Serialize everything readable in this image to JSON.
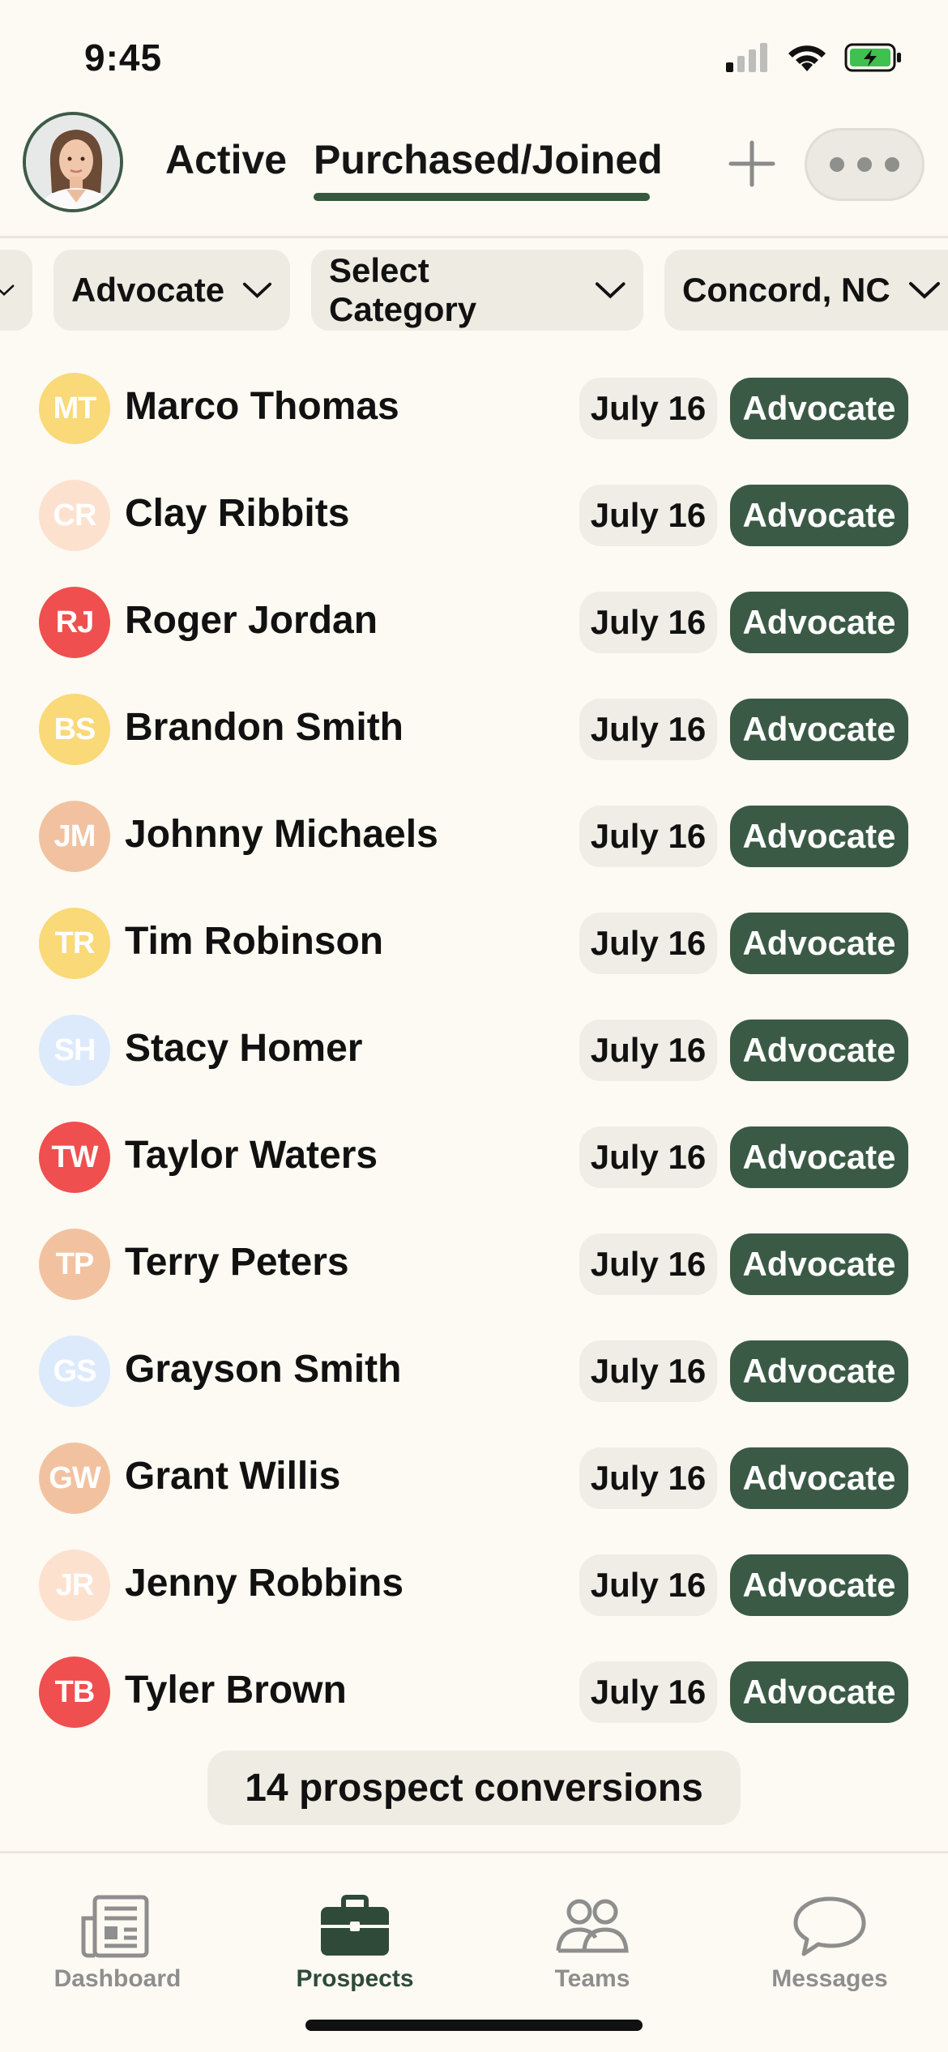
{
  "status_bar": {
    "time": "9:45"
  },
  "header": {
    "tabs": [
      {
        "label": "Active",
        "selected": false
      },
      {
        "label": "Purchased/Joined",
        "selected": true
      }
    ],
    "accent": "#37583f"
  },
  "filters": [
    {
      "label": "Advocate"
    },
    {
      "label": "Select Category"
    },
    {
      "label": "Concord, NC"
    }
  ],
  "prospects": [
    {
      "initials": "MT",
      "name": "Marco Thomas",
      "date": "July 16",
      "status": "Advocate",
      "color": "#f9d978"
    },
    {
      "initials": "CR",
      "name": "Clay Ribbits",
      "date": "July 16",
      "status": "Advocate",
      "color": "#fde1cf"
    },
    {
      "initials": "RJ",
      "name": "Roger Jordan",
      "date": "July 16",
      "status": "Advocate",
      "color": "#ef4f4f"
    },
    {
      "initials": "BS",
      "name": "Brandon Smith",
      "date": "July 16",
      "status": "Advocate",
      "color": "#f9d978"
    },
    {
      "initials": "JM",
      "name": "Johnny Michaels",
      "date": "July 16",
      "status": "Advocate",
      "color": "#f2c2a0"
    },
    {
      "initials": "TR",
      "name": "Tim Robinson",
      "date": "July 16",
      "status": "Advocate",
      "color": "#f9d978"
    },
    {
      "initials": "SH",
      "name": "Stacy Homer",
      "date": "July 16",
      "status": "Advocate",
      "color": "#dceafc"
    },
    {
      "initials": "TW",
      "name": "Taylor Waters",
      "date": "July 16",
      "status": "Advocate",
      "color": "#ef4f4f"
    },
    {
      "initials": "TP",
      "name": "Terry Peters",
      "date": "July 16",
      "status": "Advocate",
      "color": "#f2c2a0"
    },
    {
      "initials": "GS",
      "name": "Grayson Smith",
      "date": "July 16",
      "status": "Advocate",
      "color": "#dceafc"
    },
    {
      "initials": "GW",
      "name": "Grant Willis",
      "date": "July 16",
      "status": "Advocate",
      "color": "#f2c2a0"
    },
    {
      "initials": "JR",
      "name": "Jenny Robbins",
      "date": "July 16",
      "status": "Advocate",
      "color": "#fde1cf"
    },
    {
      "initials": "TB",
      "name": "Tyler Brown",
      "date": "July 16",
      "status": "Advocate",
      "color": "#ef4f4f"
    }
  ],
  "summary": "14 prospect conversions",
  "nav": [
    {
      "label": "Dashboard",
      "icon": "newspaper-icon"
    },
    {
      "label": "Prospects",
      "icon": "briefcase-icon",
      "selected": true
    },
    {
      "label": "Teams",
      "icon": "people-icon"
    },
    {
      "label": "Messages",
      "icon": "chat-bubble-icon"
    }
  ]
}
